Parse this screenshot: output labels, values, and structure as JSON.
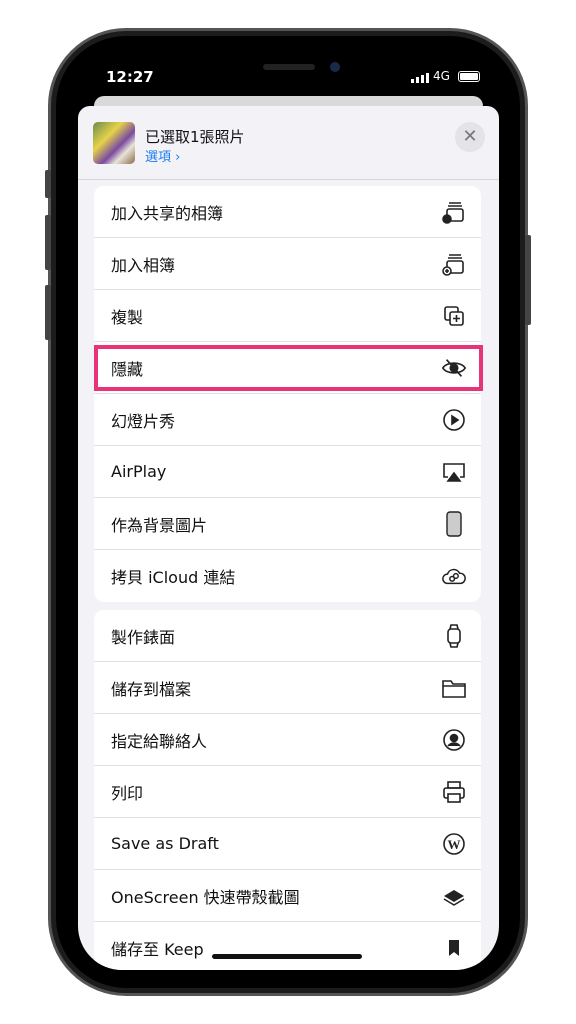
{
  "status": {
    "time": "12:27",
    "network": "4G"
  },
  "header": {
    "title": "已選取1張照片",
    "options": "選項 ›",
    "close": "✕"
  },
  "group1": [
    {
      "label": "加入共享的相簿",
      "icon": "shared-album-icon"
    },
    {
      "label": "加入相簿",
      "icon": "add-album-icon"
    },
    {
      "label": "複製",
      "icon": "duplicate-icon"
    },
    {
      "label": "隱藏",
      "icon": "eye-slash-icon",
      "highlighted": true
    },
    {
      "label": "幻燈片秀",
      "icon": "play-circle-icon"
    },
    {
      "label": "AirPlay",
      "icon": "airplay-icon"
    },
    {
      "label": "作為背景圖片",
      "icon": "iphone-icon"
    },
    {
      "label": "拷貝 iCloud 連結",
      "icon": "cloud-link-icon"
    }
  ],
  "group2": [
    {
      "label": "製作錶面",
      "icon": "watch-icon"
    },
    {
      "label": "儲存到檔案",
      "icon": "folder-icon"
    },
    {
      "label": "指定給聯絡人",
      "icon": "contact-icon"
    },
    {
      "label": "列印",
      "icon": "printer-icon"
    },
    {
      "label": "Save as Draft",
      "icon": "wordpress-icon"
    },
    {
      "label": "OneScreen  快速帶殼截圖",
      "icon": "onescreen-icon"
    },
    {
      "label": "儲存至 Keep",
      "icon": "bookmark-icon"
    }
  ],
  "colors": {
    "highlight": "#e8337a",
    "link": "#1e7cf2"
  }
}
